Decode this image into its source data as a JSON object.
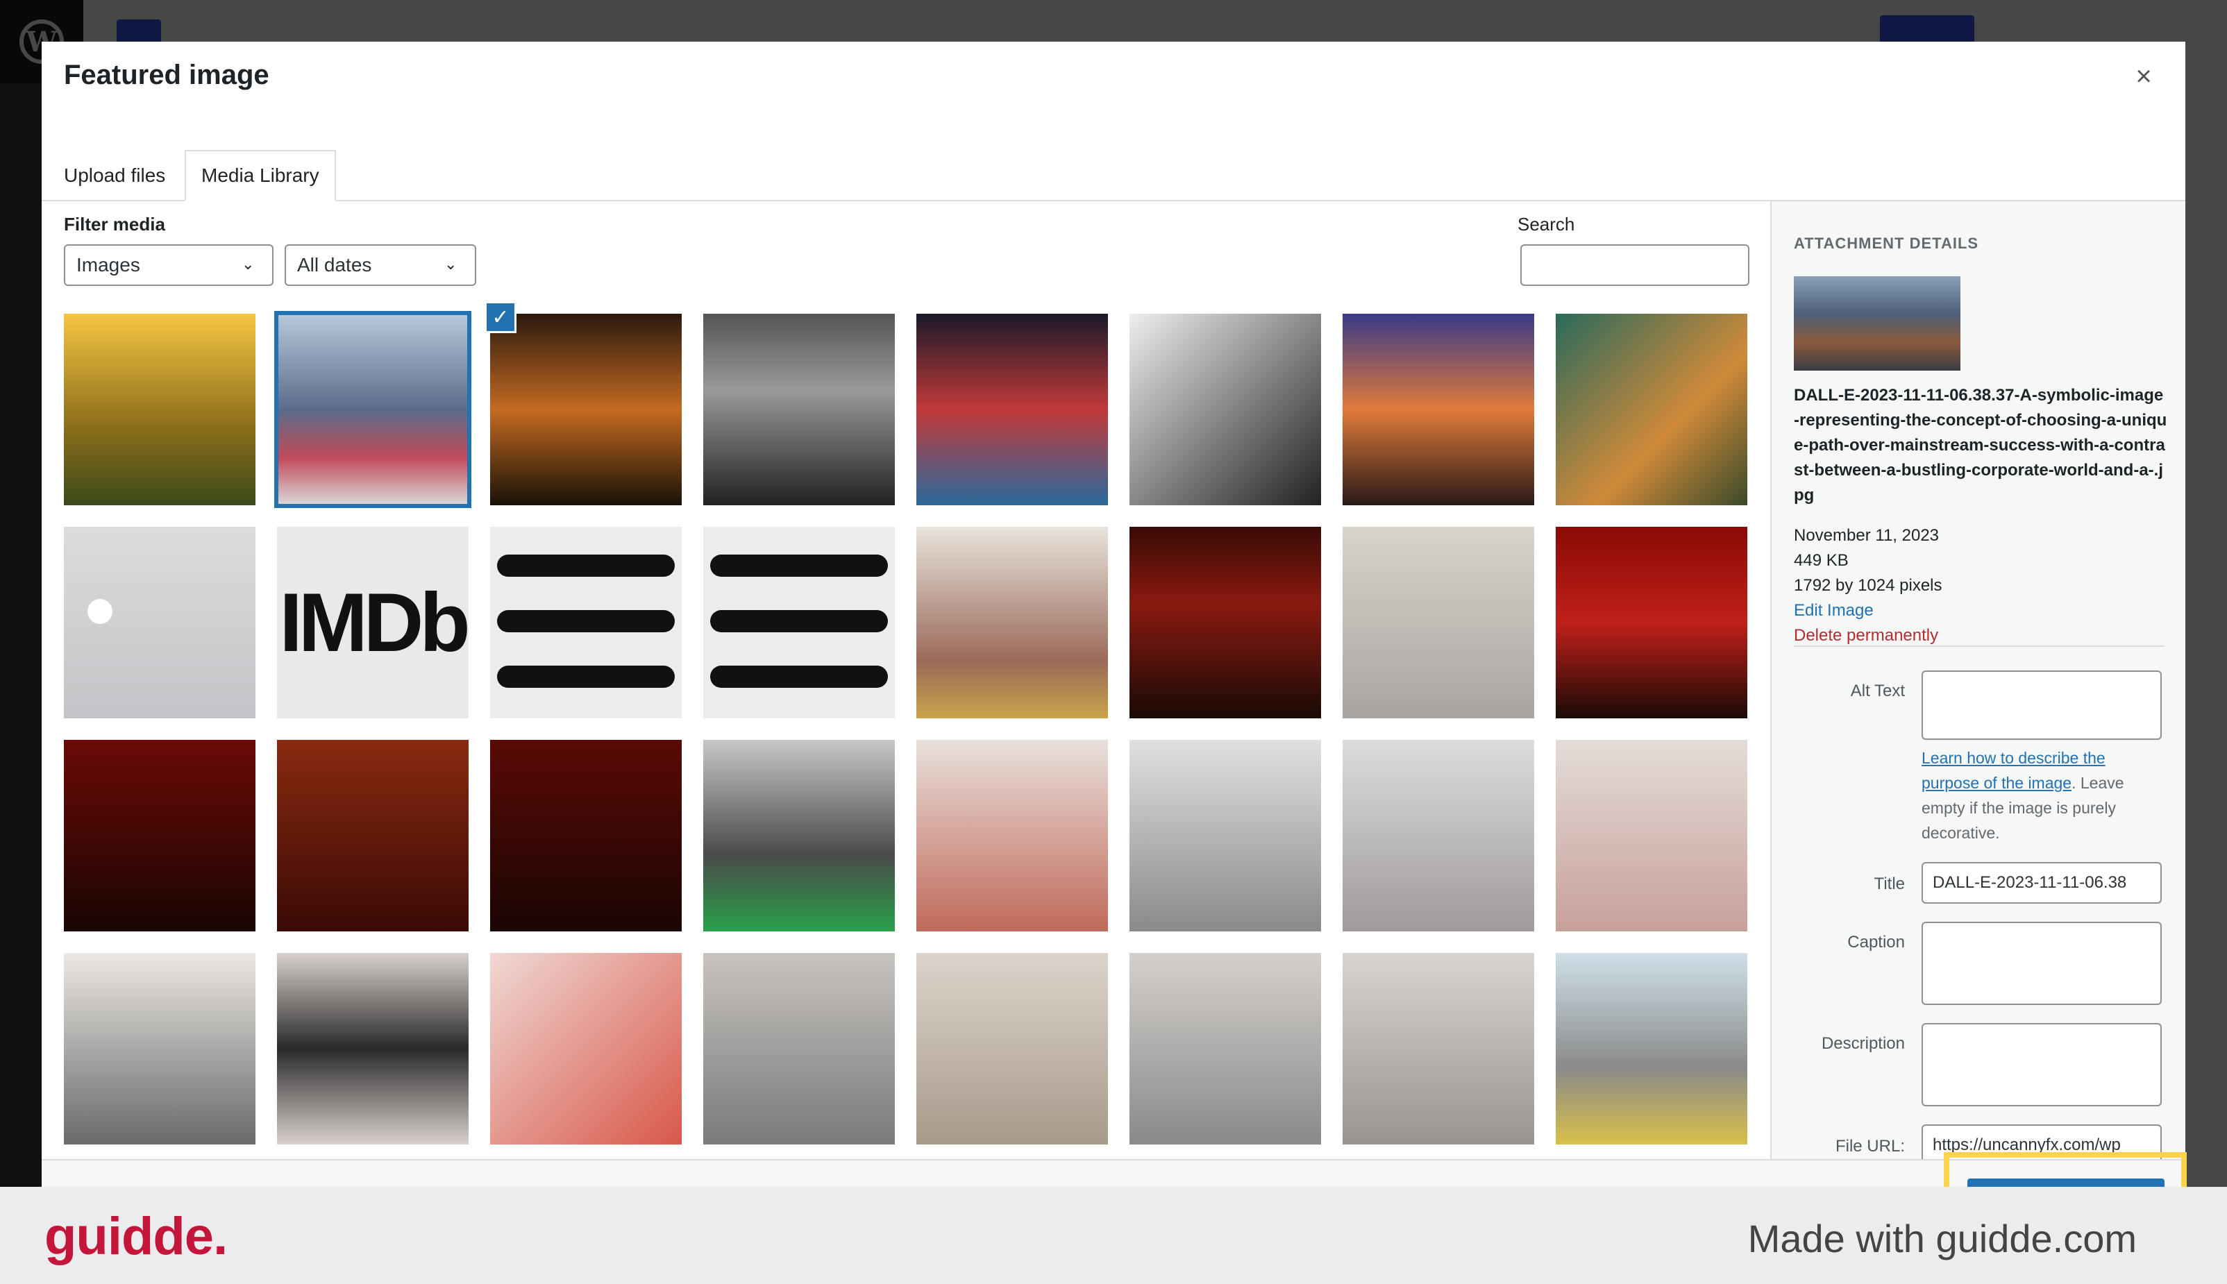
{
  "modal": {
    "title": "Featured image",
    "close_label": "×",
    "tabs": [
      {
        "label": "Upload files"
      },
      {
        "label": "Media Library"
      }
    ],
    "filter_label": "Filter media",
    "type_select": "Images",
    "date_select": "All dates",
    "search_label": "Search",
    "search_value": ""
  },
  "attachment": {
    "heading": "ATTACHMENT DETAILS",
    "filename": "DALL-E-2023-11-11-06.38.37-A-symbolic-image-representing-the-concept-of-choosing-a-unique-path-over-mainstream-success-with-a-contrast-between-a-bustling-corporate-world-and-a-.jpg",
    "date": "November 11, 2023",
    "size": "449 KB",
    "dimensions": "1792 by 1024 pixels",
    "edit_link": "Edit Image",
    "delete_link": "Delete permanently",
    "fields": {
      "alt_label": "Alt Text",
      "alt_value": "",
      "alt_help_link": "Learn how to describe the purpose of the image",
      "alt_help_text": ". Leave empty if the image is purely decorative.",
      "title_label": "Title",
      "title_value": "DALL-E-2023-11-11-06.38",
      "caption_label": "Caption",
      "caption_value": "",
      "description_label": "Description",
      "description_value": "",
      "file_url_label": "File URL:",
      "file_url_value": "https://uncannyfx.com/wp"
    }
  },
  "thumbnails": [
    "daffodils-sunrise",
    "city-colorful-house-selected",
    "train-interior",
    "dark-beach",
    "colorful-street",
    "woman-sketch",
    "book-birds-sunset",
    "forest-cottage",
    "placeholder-image",
    "imdb-logo",
    "hamburger-menu",
    "hamburger-menu",
    "blood-kitchen",
    "dark-room",
    "body-floor",
    "blood-stain",
    "dark-red-room",
    "bar-interior",
    "dark-theater",
    "directors-monitor",
    "blood-wall",
    "kitchen-blood",
    "blood-hall",
    "blood-wall-drip",
    "blood-fridge",
    "blood-window",
    "some-eat-cake-poster",
    "body-blood",
    "body-table",
    "chairs-blood",
    "body-cafe",
    "body-kitchen"
  ],
  "colors": {
    "accent": "#2271b1",
    "delete": "#b32d2e",
    "highlight": "#fbd34d",
    "guidde_brand": "#c4153b"
  },
  "watermark": {
    "logo": "guidde.",
    "made_with": "Made with guidde.com"
  }
}
